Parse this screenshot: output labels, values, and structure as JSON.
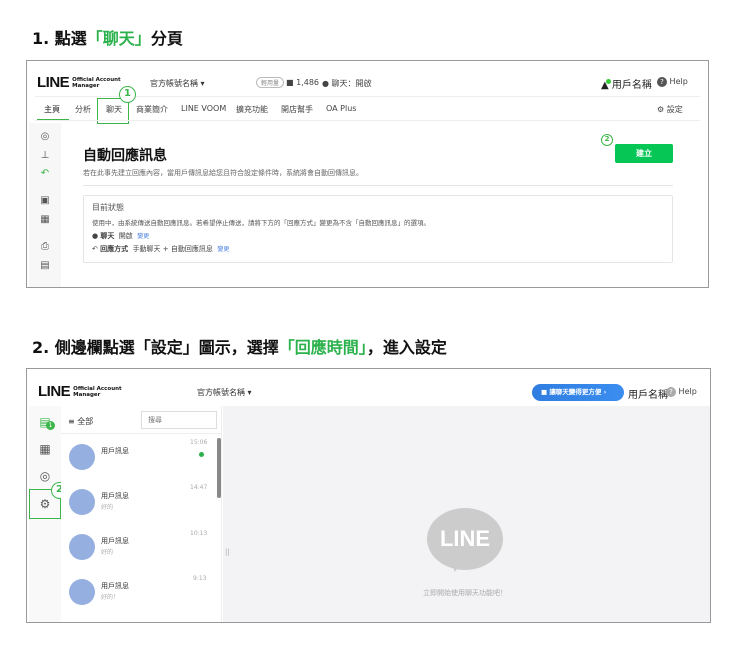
{
  "step1": {
    "heading_prefix": "1. 點選",
    "heading_highlight": "「聊天」",
    "heading_suffix": "分頁",
    "badge": "1",
    "badge2": "2"
  },
  "step2": {
    "heading_prefix": "2. 側邊欄點選「設定」圖示，選擇",
    "heading_highlight": "「回應時間」",
    "heading_suffix": "，進入設定",
    "badge": "2"
  },
  "logo": {
    "main": "LINE",
    "sub1": "Official Account",
    "sub2": "Manager"
  },
  "panel1": {
    "account_name": "官方帳號名稱",
    "plan_badge": "輕用量",
    "followers": "1,486",
    "chat_status": "聊天：開啟",
    "user_name": "用戶名稱",
    "help": "Help",
    "tabs": [
      "主頁",
      "分析",
      "聊天",
      "商業簡介",
      "LINE VOOM",
      "擴充功能",
      "開店幫手",
      "OA Plus"
    ],
    "settings": "設定",
    "title": "自動回應訊息",
    "description": "若在此事先建立回應內容，當用戶傳訊息給您且符合設定條件時，系統將會自動回傳訊息。",
    "create_button": "建立",
    "status": {
      "title": "目前狀態",
      "text": "使用中，由系統傳送自動回應訊息。若希望停止傳送，請將下方的「回應方式」變更為不含「自動回應訊息」的選項。",
      "chat_label": "聊天",
      "chat_value": "開啟",
      "change": "變更",
      "mode_label": "回應方式",
      "mode_value": "手動聊天 + 自動回應訊息"
    }
  },
  "panel2": {
    "account_name": "官方帳號名稱",
    "promo_button": "讓聊天變得更方便",
    "user_name": "用戶名稱",
    "help": "Help",
    "chat_badge": "1",
    "filter": "全部",
    "search_placeholder": "搜尋",
    "chats": [
      {
        "name": "用戶訊息",
        "preview": "",
        "time": "15:06",
        "unread": true
      },
      {
        "name": "用戶訊息",
        "preview": "好的",
        "time": "14:47"
      },
      {
        "name": "用戶訊息",
        "preview": "好的",
        "time": "10:13"
      },
      {
        "name": "用戶訊息",
        "preview": "好的！",
        "time": "9:13"
      }
    ],
    "empty_logo": "LINE",
    "empty_text": "立即開始使用聊天功能吧！"
  },
  "colors": {
    "green": "#06c755",
    "blue": "#2f7de1"
  }
}
